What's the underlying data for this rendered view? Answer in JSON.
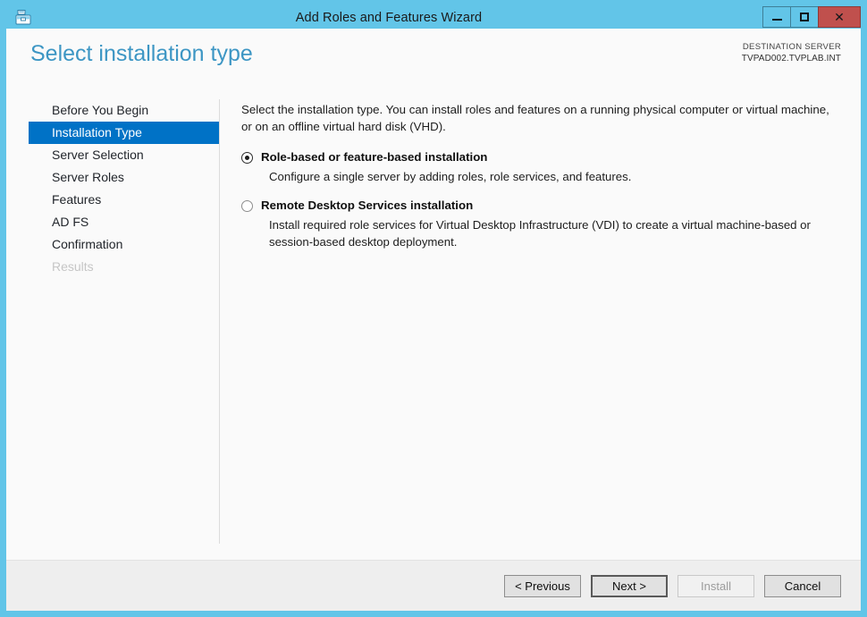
{
  "window": {
    "title": "Add Roles and Features Wizard",
    "icon": "toolbox-icon",
    "frame_color": "#62c5e8",
    "controls": {
      "minimize_label": "–",
      "maximize_label": "□",
      "close_label": "✕"
    }
  },
  "header": {
    "page_title": "Select installation type",
    "destination_label": "DESTINATION SERVER",
    "destination_server": "TVPAD002.TVPLAB.INT",
    "title_color": "#3d96c4"
  },
  "sidebar": {
    "selected_color": "#0072c6",
    "items": [
      {
        "label": "Before You Begin",
        "state": "enabled"
      },
      {
        "label": "Installation Type",
        "state": "selected"
      },
      {
        "label": "Server Selection",
        "state": "enabled"
      },
      {
        "label": "Server Roles",
        "state": "enabled"
      },
      {
        "label": "Features",
        "state": "enabled"
      },
      {
        "label": "AD FS",
        "state": "enabled"
      },
      {
        "label": "Confirmation",
        "state": "enabled"
      },
      {
        "label": "Results",
        "state": "disabled"
      }
    ]
  },
  "content": {
    "intro": "Select the installation type. You can install roles and features on a running physical computer or virtual machine, or on an offline virtual hard disk (VHD).",
    "options": [
      {
        "label": "Role-based or feature-based installation",
        "description": "Configure a single server by adding roles, role services, and features.",
        "selected": true
      },
      {
        "label": "Remote Desktop Services installation",
        "description": "Install required role services for Virtual Desktop Infrastructure (VDI) to create a virtual machine-based or session-based desktop deployment.",
        "selected": false
      }
    ]
  },
  "footer": {
    "buttons": [
      {
        "label": "< Previous",
        "state": "enabled"
      },
      {
        "label": "Next >",
        "state": "default"
      },
      {
        "label": "Install",
        "state": "disabled"
      },
      {
        "label": "Cancel",
        "state": "enabled"
      }
    ]
  }
}
